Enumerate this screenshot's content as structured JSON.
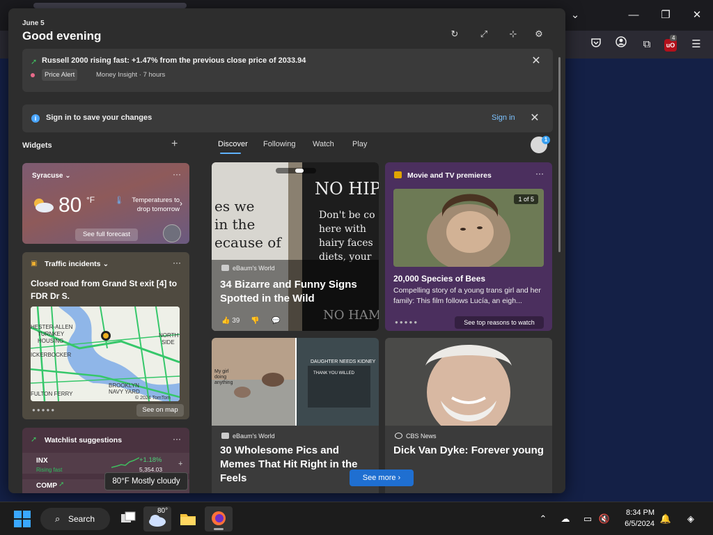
{
  "browser": {
    "ublock_badge": "4"
  },
  "panel": {
    "date": "June 5",
    "greeting": "Good evening"
  },
  "alert": {
    "title": "Russell 2000 rising fast: +1.47% from the previous close price of 2033.94",
    "tag": "Price Alert",
    "meta": "Money Insight · 7 hours"
  },
  "signin": {
    "text": "Sign in to save your changes",
    "link": "Sign in"
  },
  "widgets": {
    "title": "Widgets"
  },
  "tabs": [
    "Discover",
    "Following",
    "Watch",
    "Play"
  ],
  "avatar_badge": "1",
  "weather": {
    "location": "Syracuse",
    "temp": "80",
    "unit": "°F",
    "note": "Temperatures to drop tomorrow",
    "button": "See full forecast"
  },
  "traffic": {
    "title": "Traffic incidents",
    "desc": "Closed road from Grand St exit [4] to FDR Dr S.",
    "button": "See on map",
    "map_labels": [
      "HESTER-ALLEN",
      "TURNKEY",
      "HOUSING",
      "ICKERBOCKER",
      "FULTON FERRY",
      "BROOKLYN",
      "NAVY YARD",
      "NORTH",
      "SIDE",
      "© 2024 TomTom"
    ]
  },
  "watchlist": {
    "title": "Watchlist suggestions",
    "rows": [
      {
        "symbol": "INX",
        "sub": "Rising fast",
        "pct": "+1.18%",
        "price": "5,354.03"
      },
      {
        "symbol": "COMP",
        "sub": "",
        "pct": "",
        "price": ""
      }
    ]
  },
  "feed": {
    "card1": {
      "source": "eBaum's World",
      "headline": "34 Bizarre and Funny Signs Spotted in the Wild",
      "likes": "39"
    },
    "card2": {
      "title": "Movie and TV premieres",
      "count": "1 of 5",
      "headline": "20,000 Species of Bees",
      "desc": "Compelling story of a young trans girl and her family: This film follows Lucía, an eigh...",
      "button": "See top reasons to watch"
    },
    "card3": {
      "source": "eBaum's World",
      "headline": "30 Wholesome Pics and Memes That Hit Right in the Feels"
    },
    "card4": {
      "source": "CBS News",
      "headline": "Dick Van Dyke: Forever young"
    }
  },
  "see_more": "See more",
  "tooltip": "80°F Mostly cloudy",
  "taskbar": {
    "search": "Search",
    "weather_temp": "80°",
    "time": "8:34 PM",
    "date": "6/5/2024"
  },
  "colors": {
    "accent": "#1f6fd1",
    "link": "#7cc2ff",
    "positive": "#3fbf5f"
  }
}
